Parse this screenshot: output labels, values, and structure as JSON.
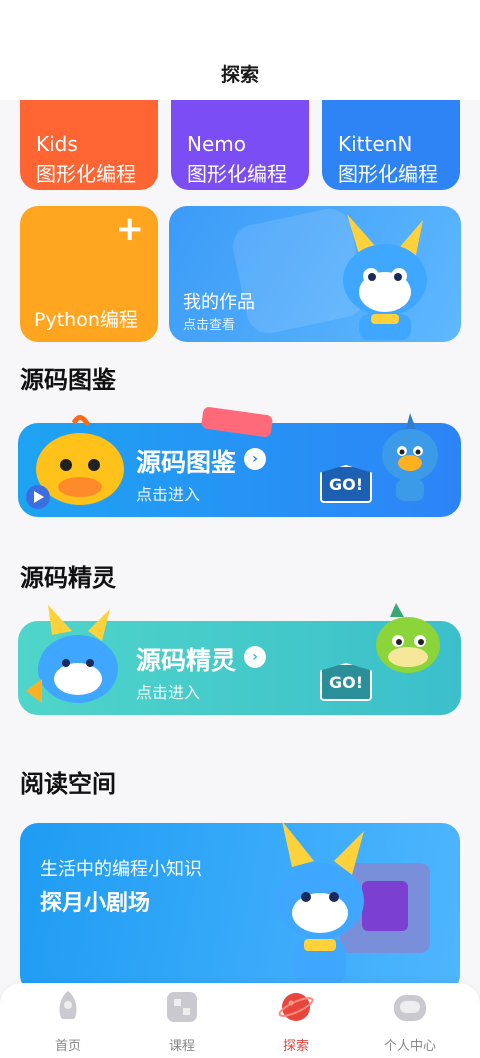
{
  "header": {
    "title": "探索"
  },
  "cards": {
    "kids": {
      "name": "Kids",
      "sub": "图形化编程"
    },
    "nemo": {
      "name": "Nemo",
      "sub": "图形化编程"
    },
    "kitten": {
      "name": "KittenN",
      "sub": "图形化编程"
    },
    "python": {
      "label": "Python编程",
      "plus": "+"
    },
    "works": {
      "title": "我的作品",
      "sub": "点击查看"
    }
  },
  "sections": {
    "source_atlas": {
      "heading": "源码图鉴",
      "banner_title": "源码图鉴",
      "banner_sub": "点击进入",
      "badge": "GO!"
    },
    "source_spirit": {
      "heading": "源码精灵",
      "banner_title": "源码精灵",
      "banner_sub": "点击进入",
      "badge": "GO!"
    },
    "reading": {
      "heading": "阅读空间",
      "sub": "生活中的编程小知识",
      "title": "探月小剧场"
    }
  },
  "tabbar": {
    "items": [
      {
        "label": "首页",
        "icon": "rocket-icon"
      },
      {
        "label": "课程",
        "icon": "course-icon"
      },
      {
        "label": "探索",
        "icon": "planet-icon",
        "active": true
      },
      {
        "label": "个人中心",
        "icon": "robot-face-icon"
      }
    ]
  },
  "colors": {
    "kids": "#ff6433",
    "nemo": "#7b4ef5",
    "kitten": "#2f84f5",
    "python": "#ffa51f",
    "active_tab": "#e8453c"
  }
}
